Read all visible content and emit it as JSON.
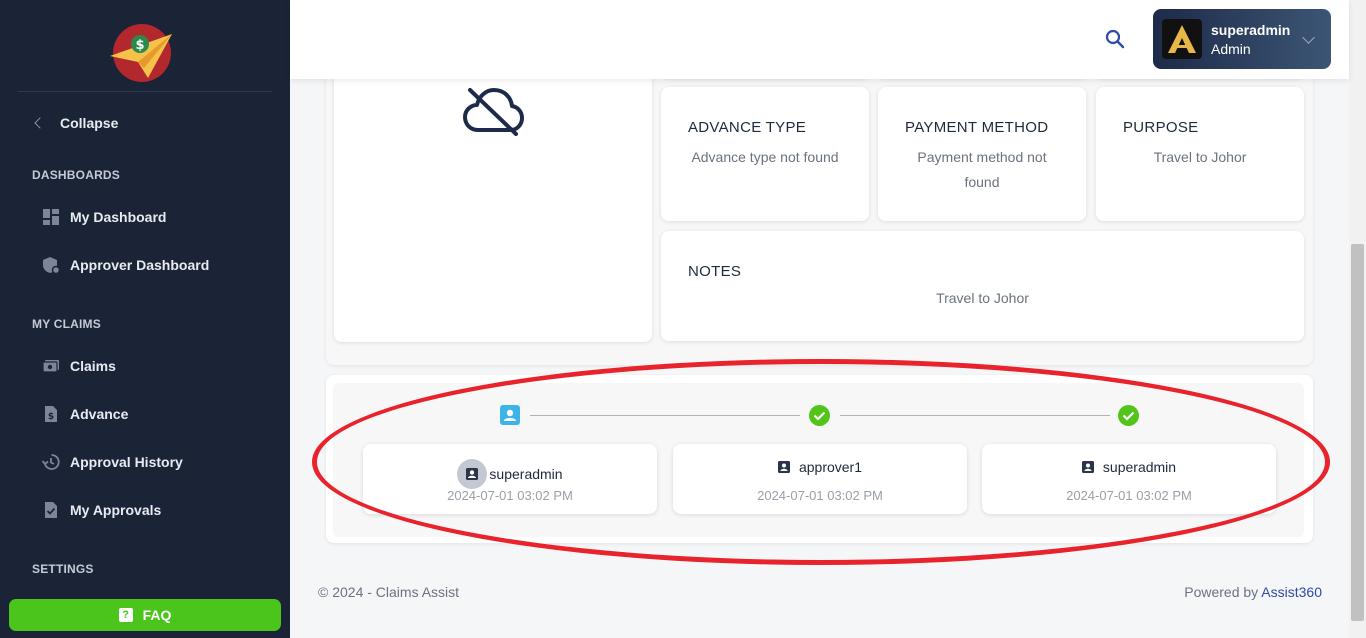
{
  "sidebar": {
    "collapse_label": "Collapse",
    "sections": {
      "dashboards": "DASHBOARDS",
      "my_claims": "MY CLAIMS",
      "settings": "SETTINGS"
    },
    "items": {
      "my_dashboard": "My Dashboard",
      "approver_dashboard": "Approver Dashboard",
      "claims": "Claims",
      "advance": "Advance",
      "approval_history": "Approval History",
      "my_approvals": "My Approvals"
    },
    "faq_label": "FAQ"
  },
  "header": {
    "user": {
      "name": "superadmin",
      "role": "Admin"
    }
  },
  "details": {
    "advance_type": {
      "title": "ADVANCE TYPE",
      "value": "Advance type not found"
    },
    "payment_method": {
      "title": "PAYMENT METHOD",
      "value": "Payment method not found"
    },
    "purpose": {
      "title": "PURPOSE",
      "value": "Travel to Johor"
    },
    "notes": {
      "title": "NOTES",
      "value": "Travel to Johor"
    }
  },
  "timeline": {
    "steps": [
      {
        "name": "superadmin",
        "date": "2024-07-01 03:02 PM",
        "status": "current"
      },
      {
        "name": "approver1",
        "date": "2024-07-01 03:02 PM",
        "status": "approved"
      },
      {
        "name": "superadmin",
        "date": "2024-07-01 03:02 PM",
        "status": "approved"
      }
    ]
  },
  "footer": {
    "copyright": "© 2024 - Claims Assist",
    "powered_by": "Powered by",
    "powered_link": "Assist360"
  },
  "colors": {
    "sidebar_bg": "#1b2336",
    "accent_green": "#4bc41c",
    "check_green": "#52c41a",
    "annotation_red": "#e8232b",
    "link_blue": "#2f4aa8"
  }
}
